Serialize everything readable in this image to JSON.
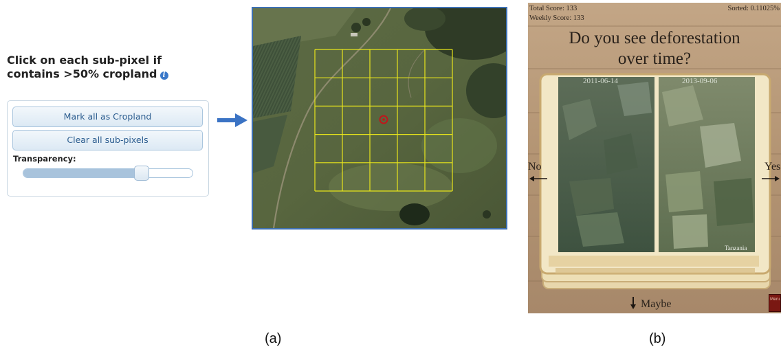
{
  "panel_a": {
    "title_line1": "Click on each sub-pixel if",
    "title_line2": "contains >50% cropland",
    "info_icon": "info-icon",
    "mark_all_label": "Mark all as Cropland",
    "clear_all_label": "Clear all sub-pixels",
    "transparency_label": "Transparency:",
    "transparency_value": 0.7,
    "grid_rows": 5,
    "grid_cols": 5,
    "grid_color": "#e8e51b",
    "marker_color": "#c0161b",
    "arrow_color": "#3b73c4",
    "frame_color": "#3d70b4"
  },
  "panel_b": {
    "total_score": "Total Score: 133",
    "weekly_score": "Weekly Score: 133",
    "sorted": "Sorted: 0.11025%",
    "question_line1": "Do you see deforestation",
    "question_line2": "over time?",
    "date_left": "2011-06-14",
    "date_right": "2013-09-06",
    "region": "Tanzania",
    "no_label": "No",
    "yes_label": "Yes",
    "maybe_label": "Maybe",
    "menu_label": "Menu"
  },
  "captions": {
    "a": "(a)",
    "b": "(b)"
  }
}
